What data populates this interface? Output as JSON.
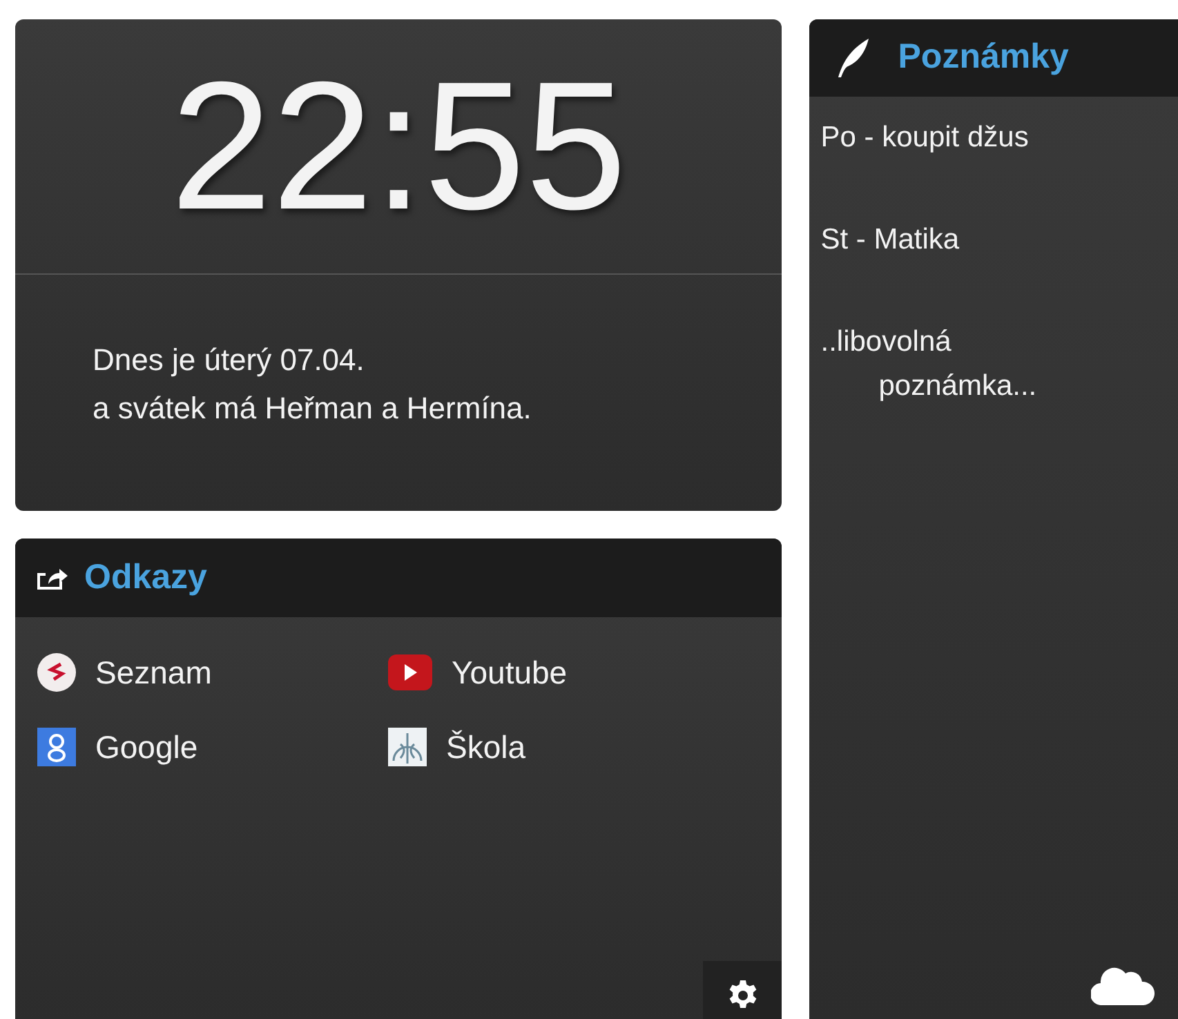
{
  "clock": {
    "time": "22:55",
    "date_line": "Dnes je úterý 07.04.",
    "nameday_line": "a svátek má Heřman a Hermína."
  },
  "links": {
    "title": "Odkazy",
    "items": [
      {
        "label": "Seznam",
        "kind": "s-circle"
      },
      {
        "label": "Youtube",
        "kind": "play"
      },
      {
        "label": "Google",
        "kind": "g-square"
      },
      {
        "label": "Škola",
        "kind": "emblem"
      }
    ]
  },
  "notes": {
    "title": "Poznámky",
    "items": [
      {
        "kind": "line",
        "lines": [
          "Po - koupit džus"
        ]
      },
      {
        "kind": "line",
        "lines": [
          "St - Matika"
        ]
      },
      {
        "kind": "wrapped",
        "lines": [
          "..libovolná",
          "poznámka..."
        ]
      }
    ]
  }
}
